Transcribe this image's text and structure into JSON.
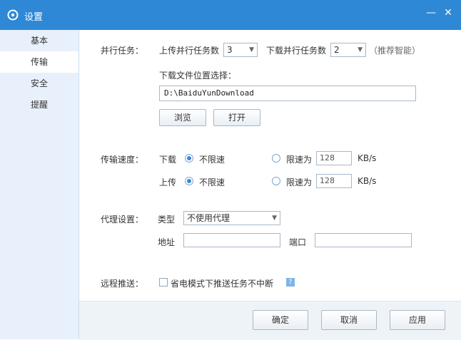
{
  "window": {
    "title": "设置",
    "minimize": "—",
    "close": "✕"
  },
  "sidebar": {
    "items": [
      {
        "label": "基本"
      },
      {
        "label": "传输"
      },
      {
        "label": "安全"
      },
      {
        "label": "提醒"
      }
    ]
  },
  "parallel": {
    "label": "并行任务：",
    "upload_label": "上传并行任务数",
    "upload_value": "3",
    "download_label": "下载并行任务数",
    "download_value": "2",
    "recommend": "（推荐智能）"
  },
  "location": {
    "label": "下载文件位置选择：",
    "path": "D:\\BaiduYunDownload",
    "browse": "浏览",
    "open": "打开"
  },
  "speed": {
    "label": "传输速度：",
    "download_label": "下载",
    "upload_label": "上传",
    "unlimited": "不限速",
    "limit_label": "限速为",
    "download_limit": "128",
    "upload_limit": "128",
    "unit": "KB/s"
  },
  "proxy": {
    "label": "代理设置：",
    "type_label": "类型",
    "type_value": "不使用代理",
    "address_label": "地址",
    "port_label": "端口"
  },
  "remote": {
    "label": "远程推送：",
    "checkbox_label": "省电模式下推送任务不中断",
    "help": "?"
  },
  "footer": {
    "ok": "确定",
    "cancel": "取消",
    "apply": "应用"
  }
}
